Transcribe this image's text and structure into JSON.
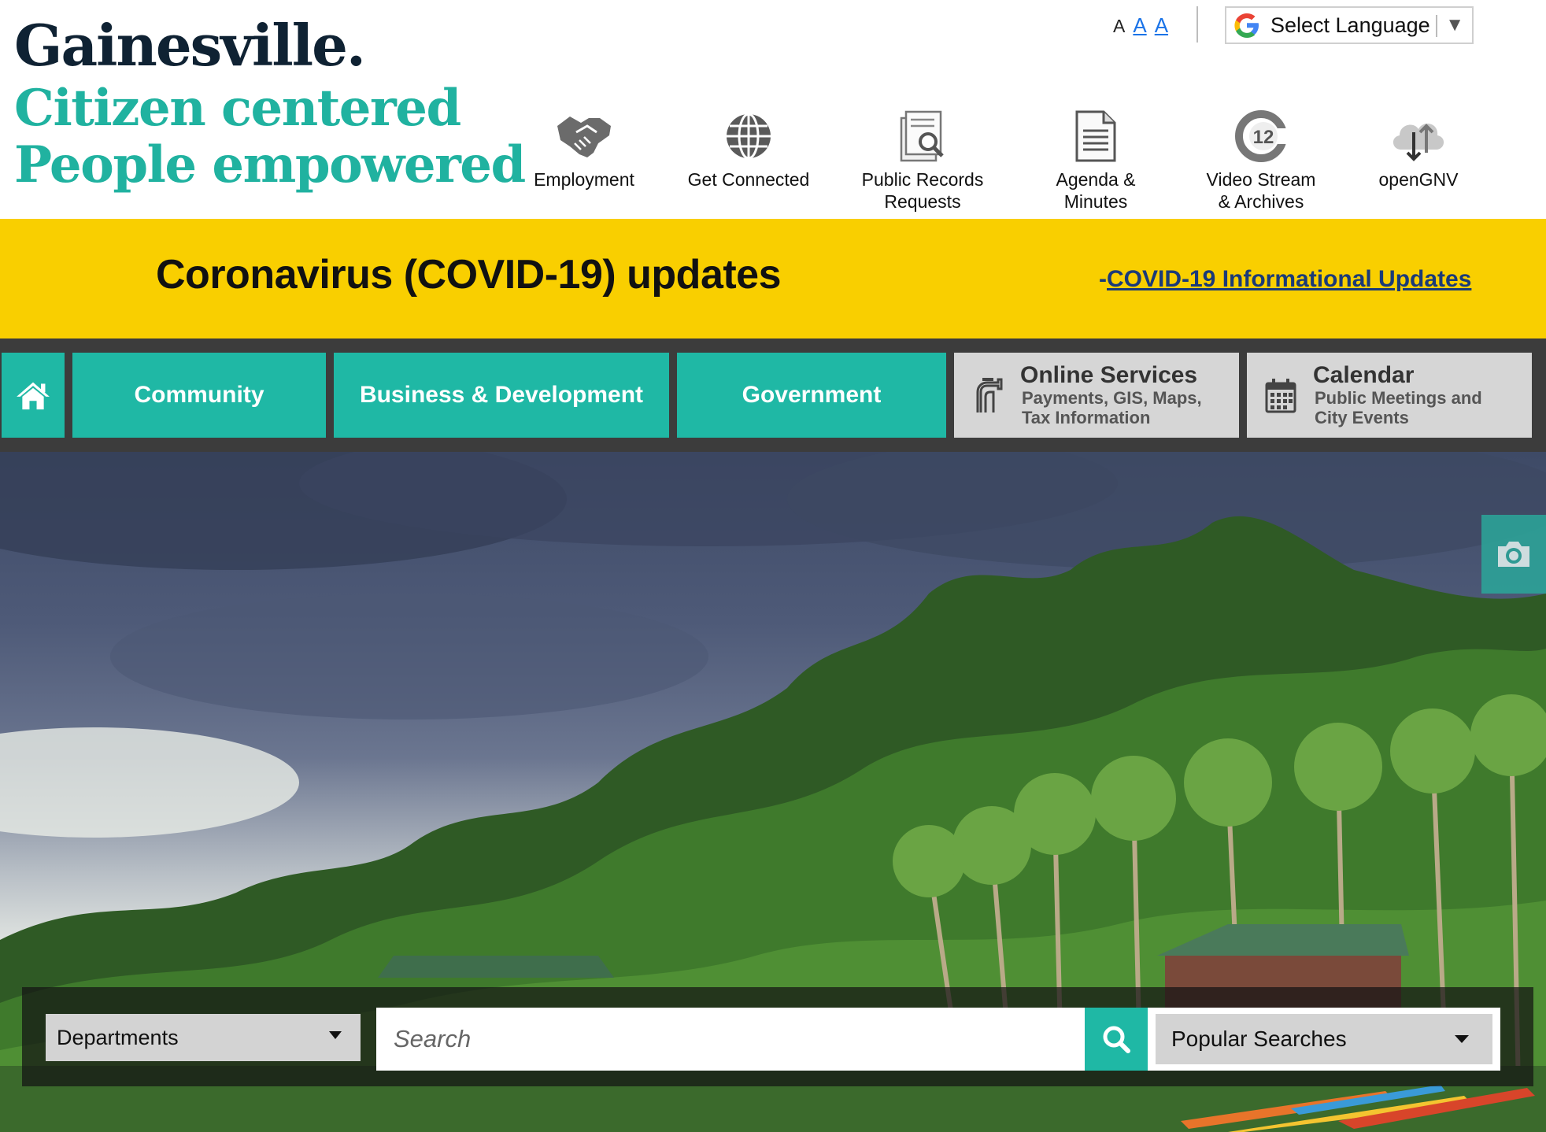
{
  "brand": {
    "name": "Gainesville.",
    "tagline_line1": "Citizen centered",
    "tagline_line2": "People empowered"
  },
  "text_size": {
    "small": "A",
    "medium": "A",
    "large": "A"
  },
  "language": {
    "label": "Select Language",
    "icon": "google-g-icon"
  },
  "quick_links": [
    {
      "label": "Employment",
      "icon": "handshake-icon"
    },
    {
      "label": "Get Connected",
      "icon": "globe-icon"
    },
    {
      "label": "Public Records\nRequests",
      "icon": "records-search-icon"
    },
    {
      "label": "Agenda &\nMinutes",
      "icon": "document-icon"
    },
    {
      "label": "Video Stream\n& Archives",
      "icon": "channel-12-icon"
    },
    {
      "label": "openGNV",
      "icon": "cloud-updown-icon"
    }
  ],
  "banner": {
    "title": "Coronavirus (COVID-19) updates",
    "link_prefix": "-",
    "link_text": "COVID-19 Informational Updates"
  },
  "nav": {
    "home_icon": "home-icon",
    "community": "Community",
    "business": "Business & Development",
    "government": "Government",
    "online_services": {
      "title": "Online Services",
      "subtitle_line1": "Payments, GIS, Maps,",
      "subtitle_line2": "Tax Information",
      "icon": "water-tap-icon"
    },
    "calendar": {
      "title": "Calendar",
      "subtitle_line1": "Public Meetings and",
      "subtitle_line2": "City Events",
      "icon": "calendar-icon"
    }
  },
  "hero": {
    "camera_icon": "camera-icon"
  },
  "search": {
    "departments_label": "Departments",
    "placeholder": "Search",
    "button_icon": "search-icon",
    "popular_label": "Popular Searches"
  },
  "colors": {
    "teal": "#1fb8a5",
    "navy": "#0f2233",
    "banner_yellow": "#f9cf00",
    "nav_dark": "#3c3c3c",
    "link_blue": "#1a3a78"
  }
}
